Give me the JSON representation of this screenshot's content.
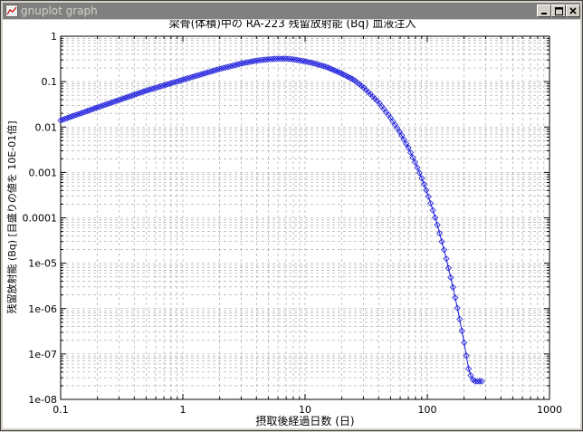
{
  "window": {
    "title": "gnuplot graph",
    "minimize_icon": "minimize-icon",
    "maximize_icon": "maximize-icon",
    "close_icon": "close-icon"
  },
  "chart_data": {
    "type": "line",
    "title": "梁骨(体積)中の RA-223  残留放射能 (Bq)    血液注入",
    "xlabel": "摂取後経過日数 (日)",
    "ylabel": "残留放射能 (Bq)   [目盛りの値を 10E-01倍]",
    "xscale": "log",
    "yscale": "log",
    "xlim": [
      0.1,
      1000
    ],
    "ylim": [
      1e-08,
      1
    ],
    "grid": true,
    "x_ticks": [
      "0.1",
      "1",
      "10",
      "100",
      "1000"
    ],
    "y_ticks": [
      "1e-08",
      "1e-07",
      "1e-06",
      "1e-05",
      "0.0001",
      "0.001",
      "0.01",
      "0.1",
      "1"
    ],
    "color": "#1a1adc",
    "series": [
      {
        "x": [
          0.1,
          0.2,
          0.5,
          1,
          2,
          3,
          4,
          5,
          6,
          7,
          8,
          10,
          12,
          15,
          20,
          25,
          30,
          40,
          50,
          60,
          70,
          80,
          90,
          100,
          110,
          120,
          140,
          160,
          180,
          200,
          220,
          240,
          260,
          280
        ],
        "y": [
          0.014,
          0.027,
          0.063,
          0.11,
          0.19,
          0.25,
          0.29,
          0.31,
          0.32,
          0.32,
          0.31,
          0.28,
          0.25,
          0.21,
          0.15,
          0.11,
          0.075,
          0.035,
          0.016,
          0.0075,
          0.0035,
          0.0016,
          0.00075,
          0.00035,
          0.00016,
          7.5e-05,
          1.6e-05,
          3.5e-06,
          8e-07,
          1.8e-07,
          4e-08,
          2.5e-08,
          2.5e-08,
          2.5e-08
        ]
      }
    ]
  }
}
